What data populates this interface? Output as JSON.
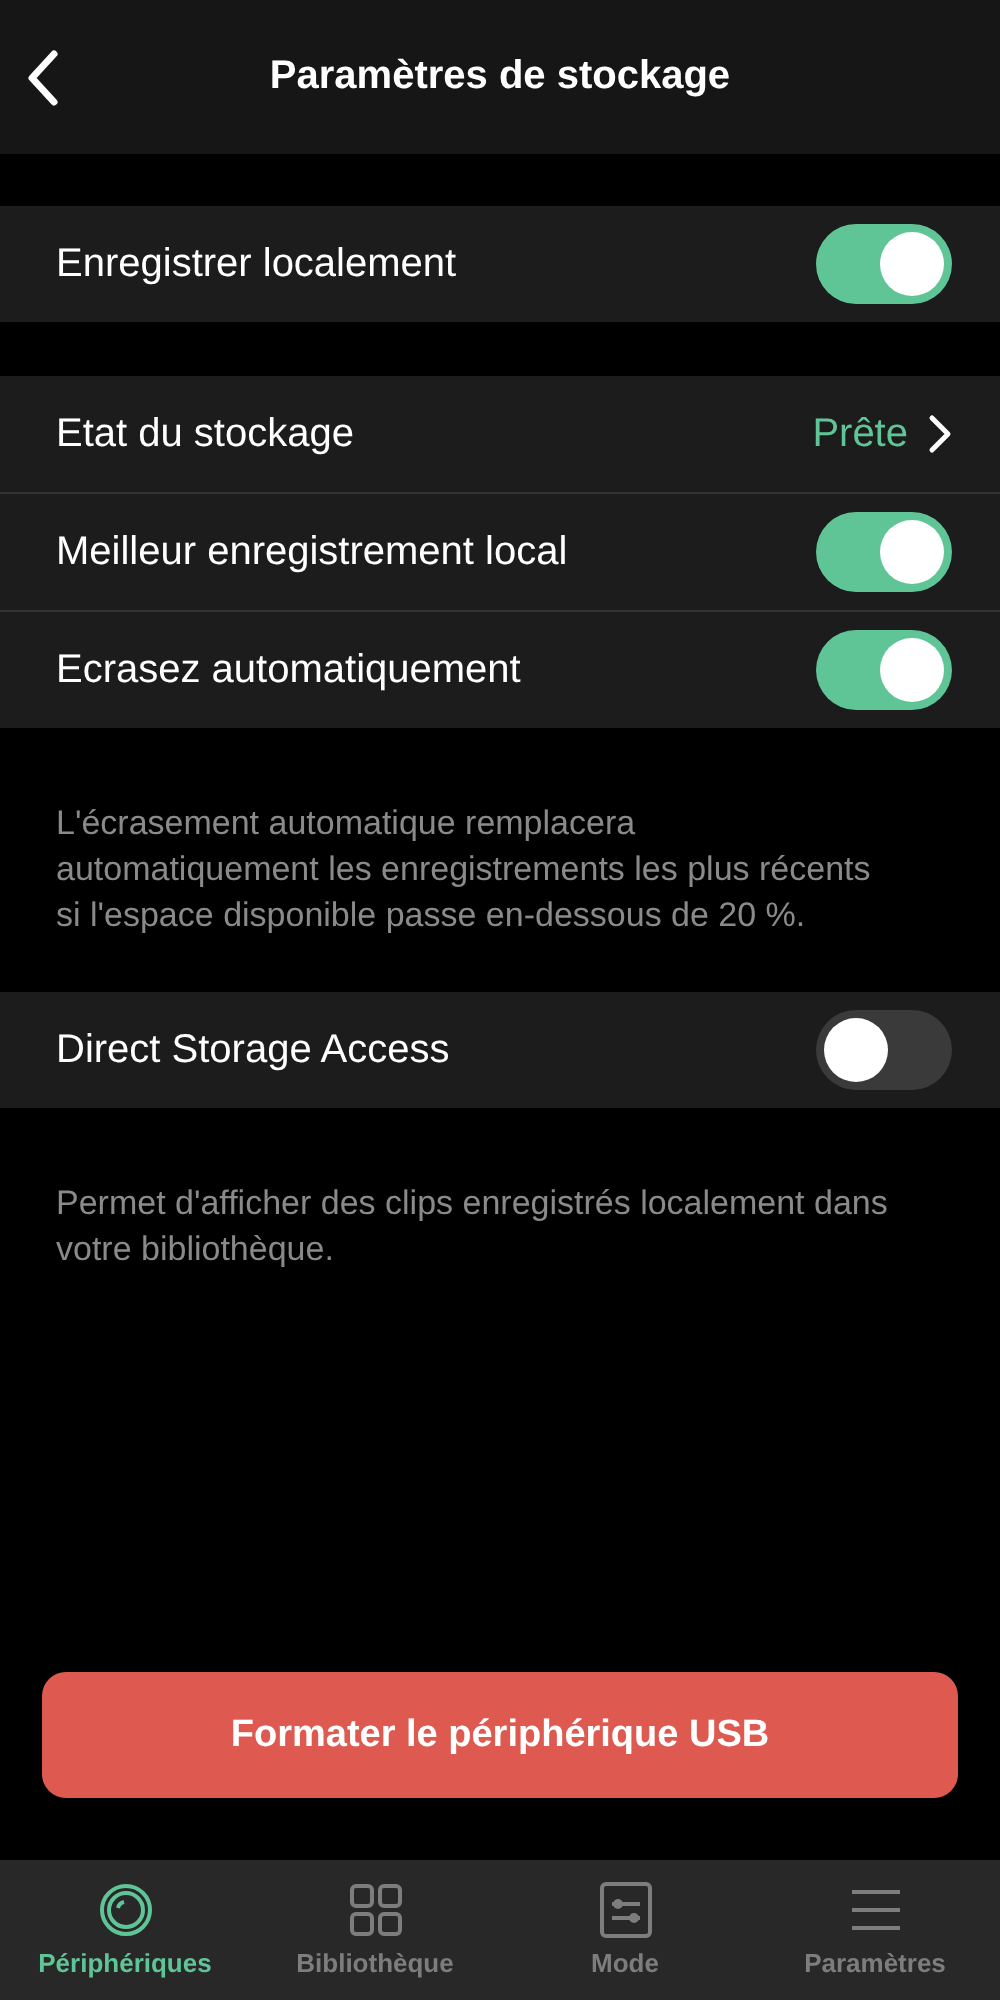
{
  "header": {
    "title": "Paramètres de stockage"
  },
  "sections": [
    {
      "rows": [
        {
          "kind": "toggle",
          "label": "Enregistrer localement",
          "on": true
        }
      ]
    },
    {
      "rows": [
        {
          "kind": "link",
          "label": "Etat du stockage",
          "value": "Prête"
        },
        {
          "kind": "toggle",
          "label": "Meilleur enregistrement local",
          "on": true
        },
        {
          "kind": "toggle",
          "label": "Ecrasez automatiquement",
          "on": true
        }
      ],
      "note": "L'écrasement automatique remplacera automatiquement les enregistrements les plus récents si l'espace disponible passe en-dessous de 20 %."
    },
    {
      "rows": [
        {
          "kind": "toggle",
          "label": "Direct Storage Access",
          "on": false
        }
      ],
      "note": "Permet d'afficher des clips enregistrés localement dans votre bibliothèque."
    }
  ],
  "action_button": "Formater le périphérique USB",
  "tabs": [
    {
      "kind": "devices",
      "label": "Périphériques",
      "selected": true
    },
    {
      "kind": "library",
      "label": "Bibliothèque",
      "selected": false
    },
    {
      "kind": "mode",
      "label": "Mode",
      "selected": false
    },
    {
      "kind": "settings",
      "label": "Paramètres",
      "selected": false
    }
  ]
}
